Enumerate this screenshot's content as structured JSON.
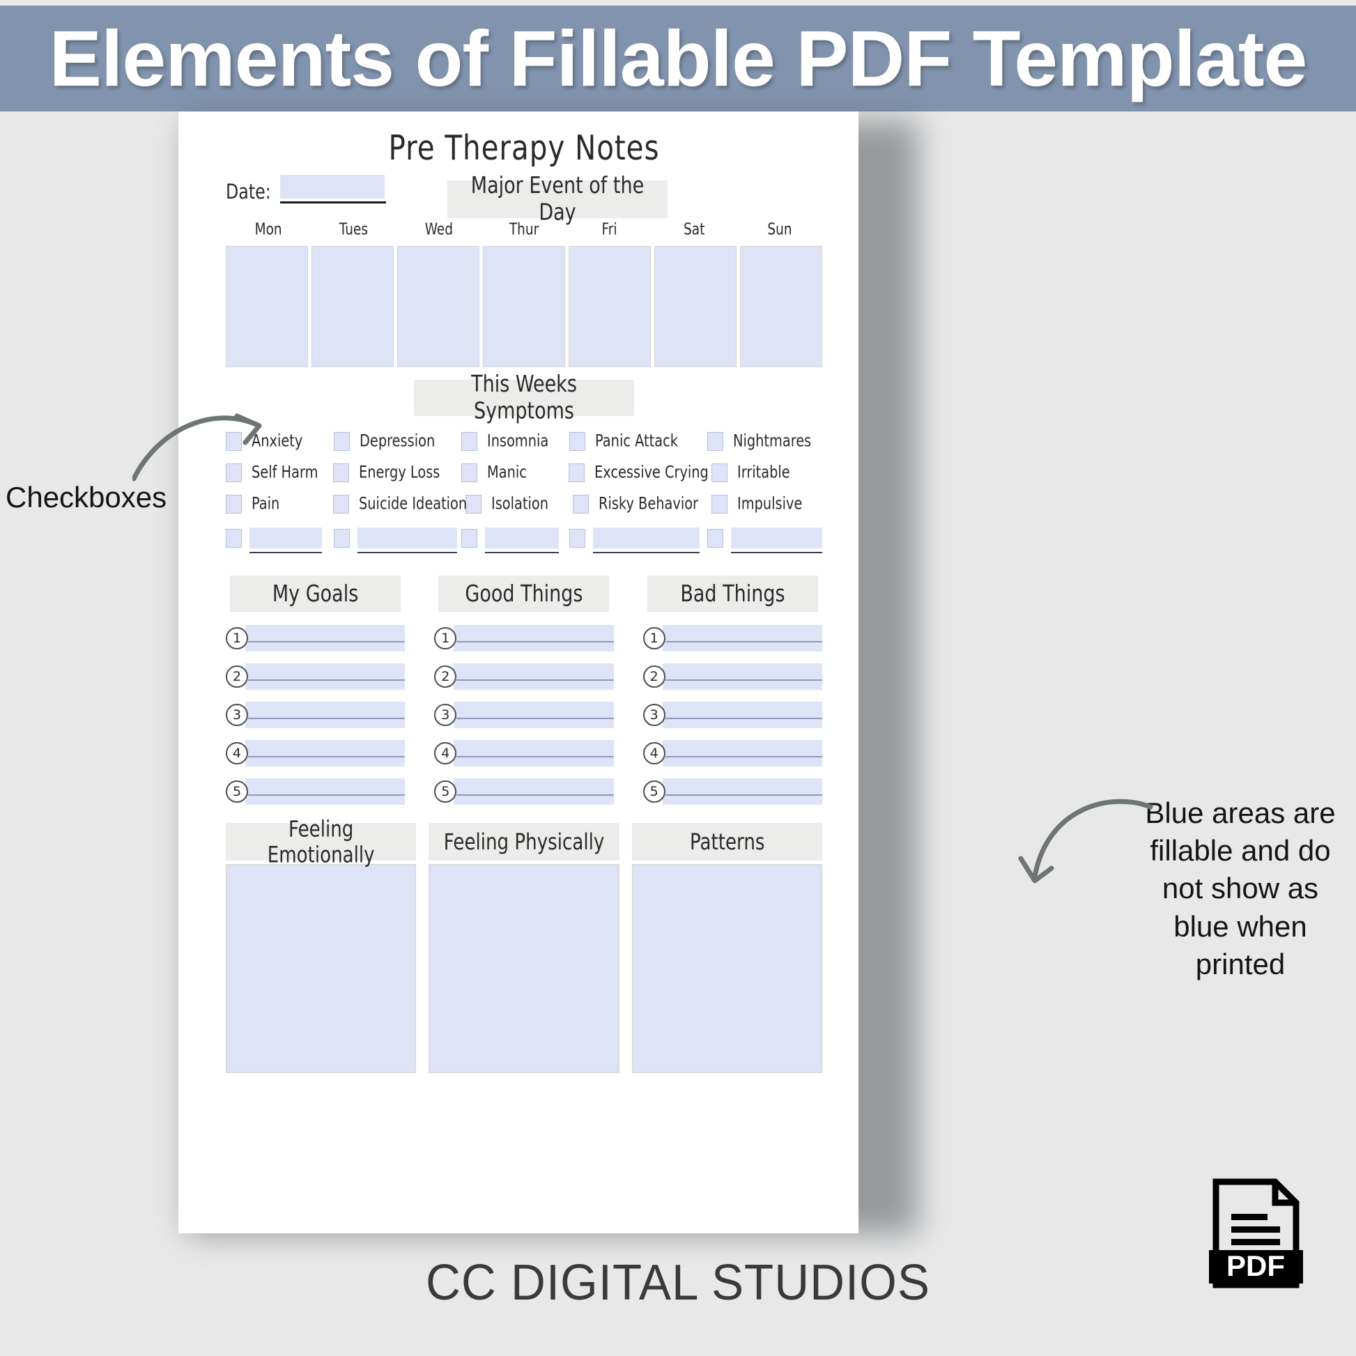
{
  "banner": {
    "title": "Elements of Fillable PDF Template",
    "bg_color": "#8193ad",
    "text_color": "#ffffff"
  },
  "colors": {
    "fillable_blue": "#dfe3f8",
    "chip_gray": "#ececeb",
    "page_bg": "#e8e8e8",
    "ink": "#2a2a2a"
  },
  "document": {
    "title": "Pre Therapy Notes",
    "date": {
      "label": "Date:",
      "value": "",
      "placeholder": ""
    },
    "major_event": {
      "header": "Major Event of the Day",
      "days": [
        "Mon",
        "Tues",
        "Wed",
        "Thur",
        "Fri",
        "Sat",
        "Sun"
      ],
      "values": [
        "",
        "",
        "",
        "",
        "",
        "",
        ""
      ]
    },
    "symptoms": {
      "header": "This Weeks Symptoms",
      "rows": [
        [
          "Anxiety",
          "Depression",
          "Insomnia",
          "Panic Attack",
          "Nightmares"
        ],
        [
          "Self Harm",
          "Energy Loss",
          "Manic",
          "Excessive Crying",
          "Irritable"
        ],
        [
          "Pain",
          "Suicide Ideation",
          "Isolation",
          "Risky Behavior",
          "Impulsive"
        ]
      ],
      "custom_row": [
        "",
        "",
        "",
        "",
        ""
      ]
    },
    "lists": [
      {
        "header": "My Goals",
        "numbers": [
          "1",
          "2",
          "3",
          "4",
          "5"
        ],
        "values": [
          "",
          "",
          "",
          "",
          ""
        ]
      },
      {
        "header": "Good Things",
        "numbers": [
          "1",
          "2",
          "3",
          "4",
          "5"
        ],
        "values": [
          "",
          "",
          "",
          "",
          ""
        ]
      },
      {
        "header": "Bad Things",
        "numbers": [
          "1",
          "2",
          "3",
          "4",
          "5"
        ],
        "values": [
          "",
          "",
          "",
          "",
          ""
        ]
      }
    ],
    "text_areas": [
      {
        "header": "Feeling Emotionally",
        "value": ""
      },
      {
        "header": "Feeling Physically",
        "value": ""
      },
      {
        "header": "Patterns",
        "value": ""
      }
    ]
  },
  "annotations": {
    "left": {
      "text": "Checkboxes",
      "icon": "curved-arrow-right-icon"
    },
    "right": {
      "text": "Blue areas are fillable and do not show as blue when printed",
      "icon": "curved-arrow-left-icon"
    }
  },
  "footer": {
    "brand": "CC DIGITAL STUDIOS",
    "pdf_badge": "PDF"
  }
}
